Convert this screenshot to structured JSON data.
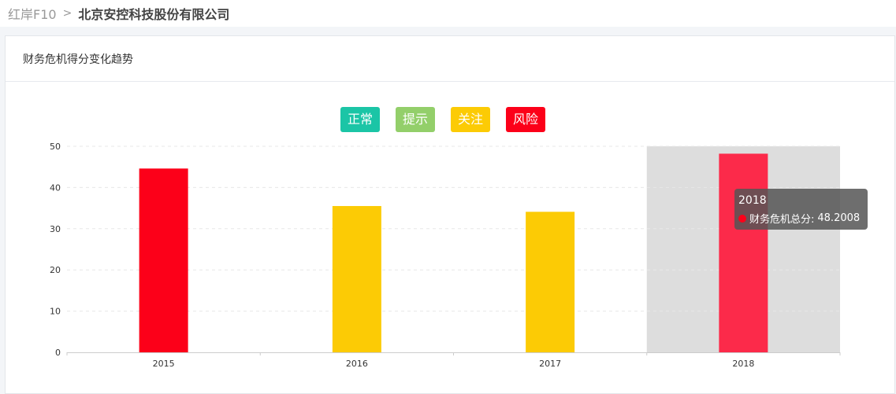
{
  "breadcrumb": {
    "root": "红岸F10",
    "separator": ">",
    "current": "北京安控科技股份有限公司"
  },
  "panel": {
    "title": "财务危机得分变化趋势"
  },
  "legend": [
    {
      "label": "正常",
      "color": "#1bc5a6"
    },
    {
      "label": "提示",
      "color": "#93cf6a"
    },
    {
      "label": "关注",
      "color": "#fccb05"
    },
    {
      "label": "风险",
      "color": "#fc0019"
    }
  ],
  "chart_data": {
    "type": "bar",
    "categories": [
      "2015",
      "2016",
      "2017",
      "2018"
    ],
    "series": [
      {
        "name": "财务危机总分",
        "values": [
          44.6,
          35.5,
          34.1,
          48.2008
        ],
        "colors": [
          "#fc0019",
          "#fccb05",
          "#fccb05",
          "#fc2a4a"
        ]
      }
    ],
    "ylim": [
      0,
      50
    ],
    "yticks": [
      0,
      10,
      20,
      30,
      40,
      50
    ],
    "grid": true,
    "highlighted_category": "2018",
    "highlight_color": "#dddddd"
  },
  "tooltip": {
    "title": "2018",
    "series_name": "财务危机总分:",
    "value": "48.2008",
    "dot_color": "#fc0019"
  }
}
